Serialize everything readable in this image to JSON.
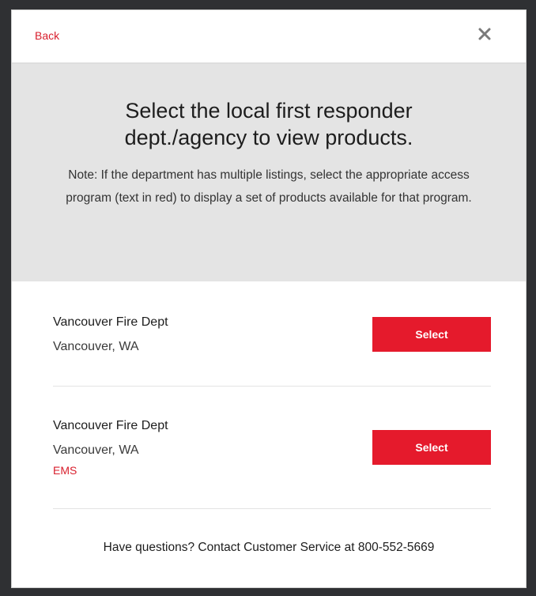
{
  "modal": {
    "back_label": "Back",
    "close_icon": "close-icon",
    "heading": "Select the local first responder dept./agency to view products.",
    "note": "Note: If the department has multiple listings, select the appropriate access program (text in red) to display a set of products available for that program."
  },
  "listings": [
    {
      "name": "Vancouver Fire Dept",
      "location": "Vancouver, WA",
      "program": "",
      "select_label": "Select"
    },
    {
      "name": "Vancouver Fire Dept",
      "location": "Vancouver, WA",
      "program": "EMS",
      "select_label": "Select"
    }
  ],
  "footer": {
    "text": "Have questions? Contact Customer Service at 800-552-5669"
  },
  "colors": {
    "accent_red": "#e51a2c",
    "link_red": "#d81e2c",
    "intro_bg": "#e4e4e4",
    "backdrop": "#2f3033"
  }
}
